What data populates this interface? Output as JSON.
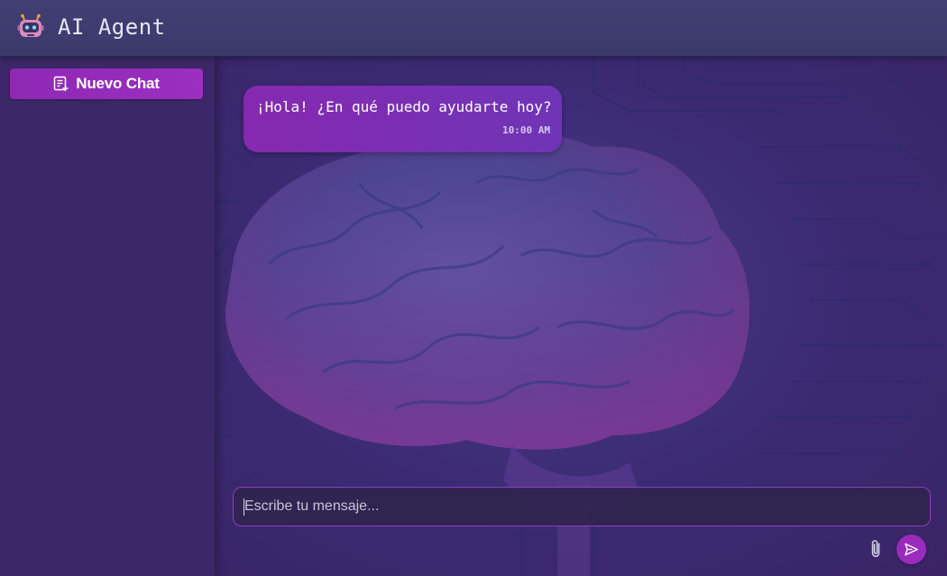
{
  "header": {
    "title": "AI Agent",
    "logo_icon": "robot-icon"
  },
  "sidebar": {
    "new_chat_label": "Nuevo Chat",
    "new_chat_icon": "new-chat-icon"
  },
  "chat": {
    "messages": [
      {
        "text": "¡Hola! ¿En qué puedo ayudarte hoy?",
        "time": "10:00 AM"
      }
    ],
    "background_art": "brain-circuit-illustration"
  },
  "composer": {
    "placeholder": "Escribe tu mensaje...",
    "value": "",
    "attach_icon": "paperclip-icon",
    "send_icon": "send-icon"
  },
  "colors": {
    "accent": "#9a2bbc",
    "header_bg": "#3f3c70",
    "sidebar_bg": "#3c2868",
    "bubble_start": "#8629b0",
    "bubble_end": "#6f35b6"
  }
}
